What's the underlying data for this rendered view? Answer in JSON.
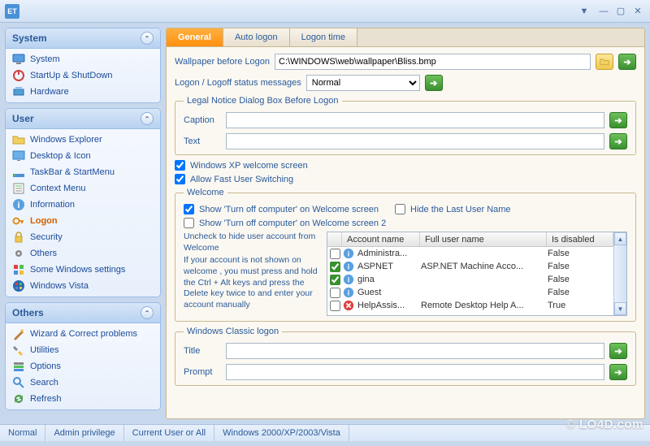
{
  "window": {
    "app_code": "ET"
  },
  "sidebar": {
    "system": {
      "title": "System",
      "items": [
        "System",
        "StartUp & ShutDown",
        "Hardware"
      ]
    },
    "user": {
      "title": "User",
      "items": [
        "Windows Explorer",
        "Desktop & Icon",
        "TaskBar & StartMenu",
        "Context Menu",
        "Information",
        "Logon",
        "Security",
        "Others",
        "Some Windows settings",
        "Windows Vista"
      ]
    },
    "others": {
      "title": "Others",
      "items": [
        "Wizard & Correct problems",
        "Utilities",
        "Options",
        "Search",
        "Refresh"
      ]
    }
  },
  "tabs": {
    "general": "General",
    "auto_logon": "Auto logon",
    "logon_time": "Logon time"
  },
  "form": {
    "wallpaper_label": "Wallpaper before Logon",
    "wallpaper_value": "C:\\WINDOWS\\web\\wallpaper\\Bliss.bmp",
    "logon_msg_label": "Logon / Logoff status messages",
    "logon_msg_value": "Normal",
    "legal_legend": "Legal Notice Dialog Box Before Logon",
    "caption_label": "Caption",
    "caption_value": "",
    "text_label": "Text",
    "text_value": "",
    "xp_welcome": "Windows XP welcome screen",
    "fast_switch": "Allow Fast User Switching",
    "welcome_legend": "Welcome",
    "show_turnoff1": "Show 'Turn off computer' on Welcome screen",
    "hide_last": "Hide the Last User Name",
    "show_turnoff2": "Show 'Turn off computer' on Welcome screen 2",
    "hint1": "Uncheck to hide user account from Welcome",
    "hint2": "If your account is not shown on welcome , you must press and hold the Ctrl + Alt keys and press the Delete key twice to and enter your account manually",
    "grid_headers": {
      "acct": "Account name",
      "full": "Full user name",
      "dis": "Is disabled"
    },
    "accounts": [
      {
        "checked": false,
        "icon": "info",
        "name": "Administra...",
        "full": "",
        "disabled": "False"
      },
      {
        "checked": true,
        "icon": "info",
        "name": "ASPNET",
        "full": "ASP.NET Machine Acco...",
        "disabled": "False"
      },
      {
        "checked": true,
        "icon": "info",
        "name": "gina",
        "full": "",
        "disabled": "False"
      },
      {
        "checked": false,
        "icon": "info",
        "name": "Guest",
        "full": "",
        "disabled": "False"
      },
      {
        "checked": false,
        "icon": "error",
        "name": "HelpAssis...",
        "full": "Remote Desktop Help A...",
        "disabled": "True"
      }
    ],
    "classic_legend": "Windows Classic logon",
    "title_label": "Title",
    "title_value": "",
    "prompt_label": "Prompt",
    "prompt_value": ""
  },
  "status": {
    "normal": "Normal",
    "admin": "Admin privilege",
    "user": "Current User or All",
    "os": "Windows 2000/XP/2003/Vista"
  },
  "watermark": "© LO4D.com"
}
